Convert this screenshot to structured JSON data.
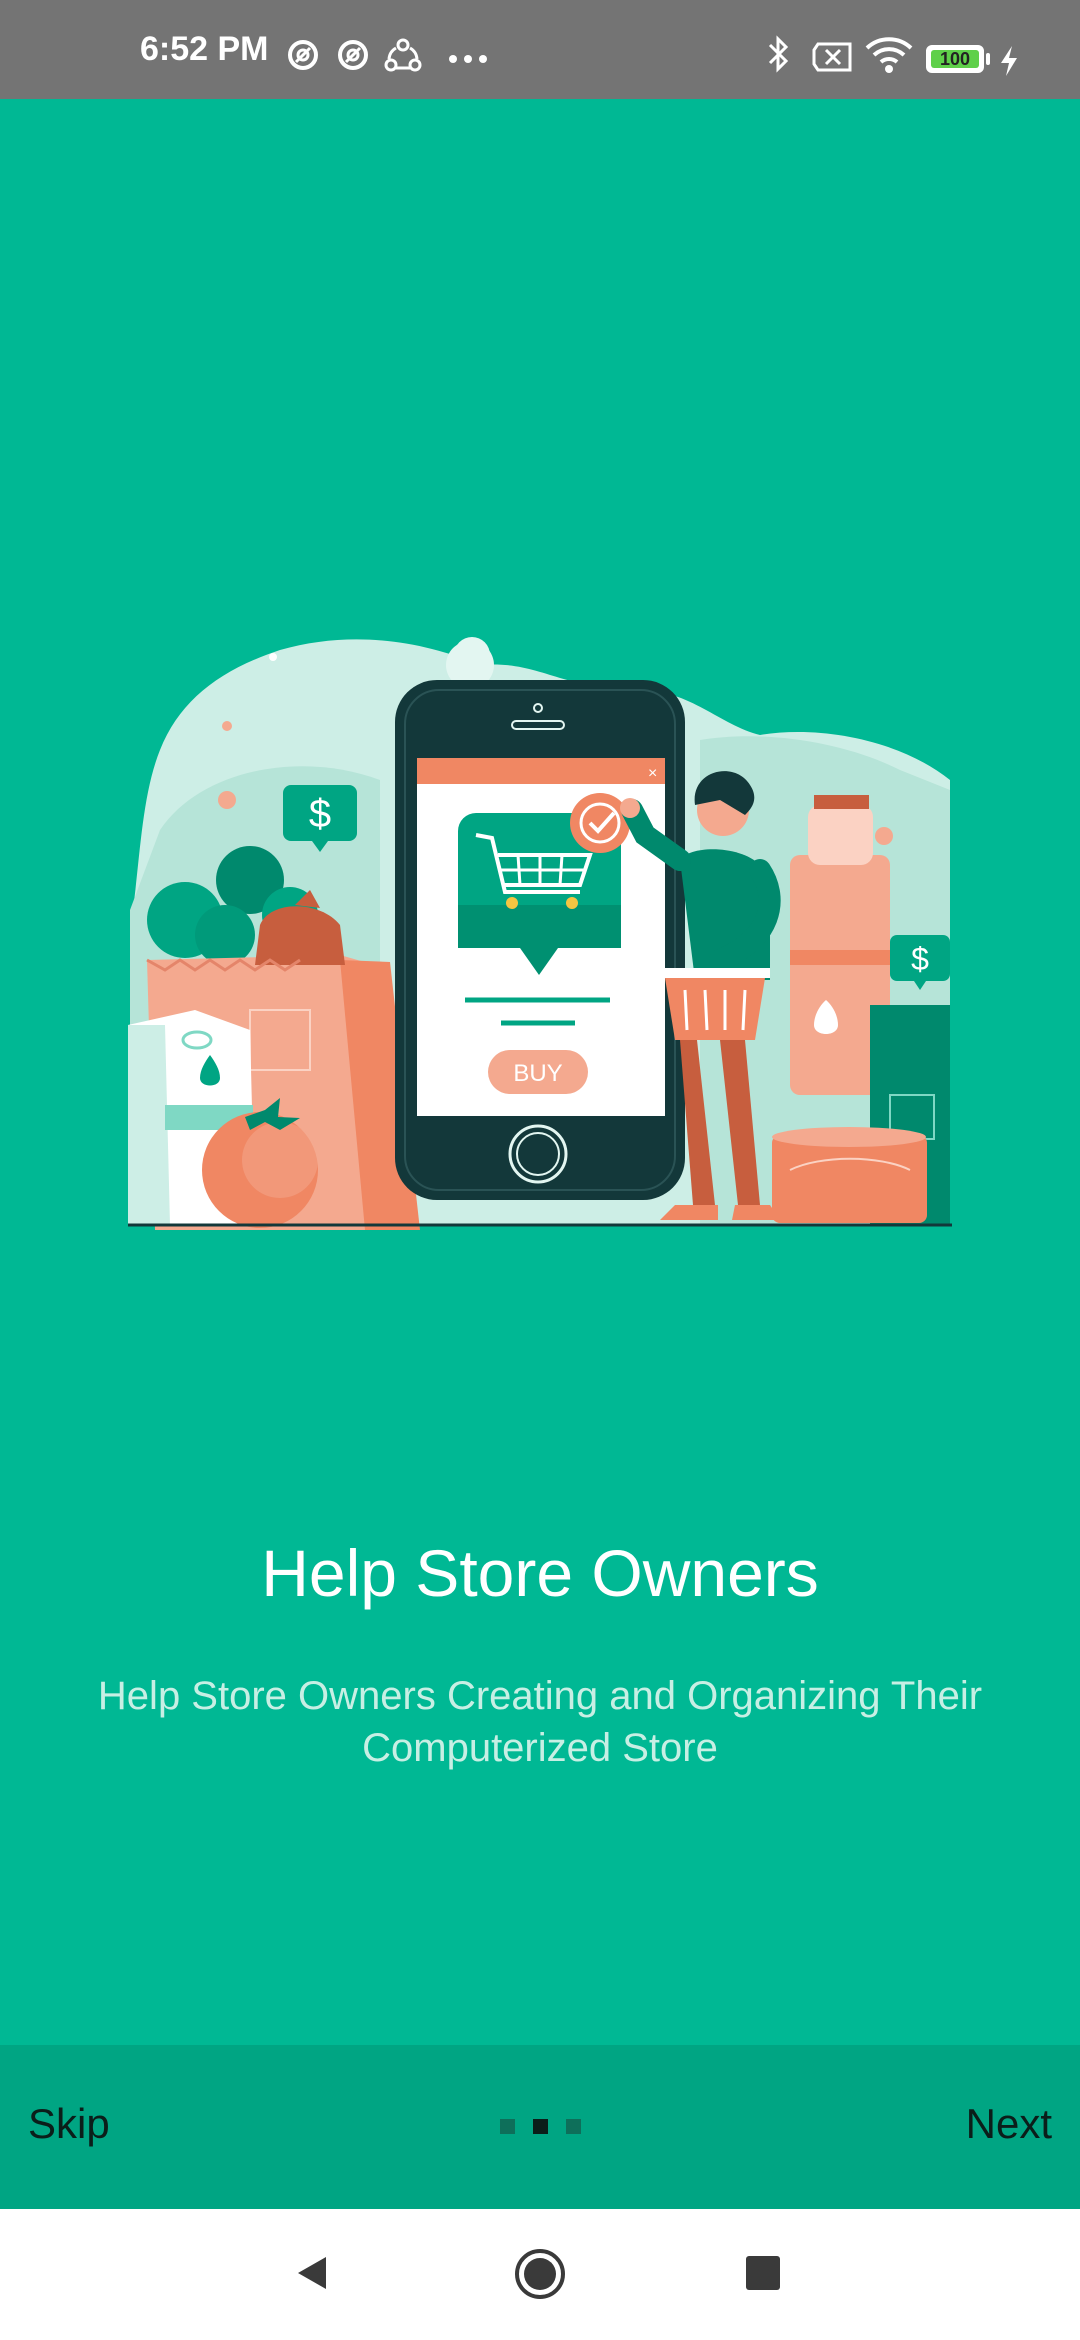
{
  "status_bar": {
    "time": "6:52 PM",
    "battery_level": "100",
    "icons": [
      "at-sign-icon",
      "at-sign-icon",
      "share-icon",
      "more-dots-icon",
      "bluetooth-icon",
      "no-sim-icon",
      "wifi-icon",
      "battery-icon",
      "charging-icon"
    ]
  },
  "onboarding": {
    "title": "Help Store Owners",
    "description": "Help Store Owners Creating and Organizing Their Computerized Store",
    "illustration": {
      "buy_label": "BUY"
    },
    "current_page": 2,
    "total_pages": 3
  },
  "bottom_bar": {
    "skip_label": "Skip",
    "next_label": "Next"
  },
  "nav_bar": {
    "buttons": [
      "back-icon",
      "home-icon",
      "recents-icon"
    ]
  },
  "colors": {
    "background": "#00b894",
    "bottom_bar": "#00a583",
    "dot_active": "#0b1e1a",
    "dot_inactive": "#0e6f5a",
    "accent_orange": "#f4876a"
  }
}
